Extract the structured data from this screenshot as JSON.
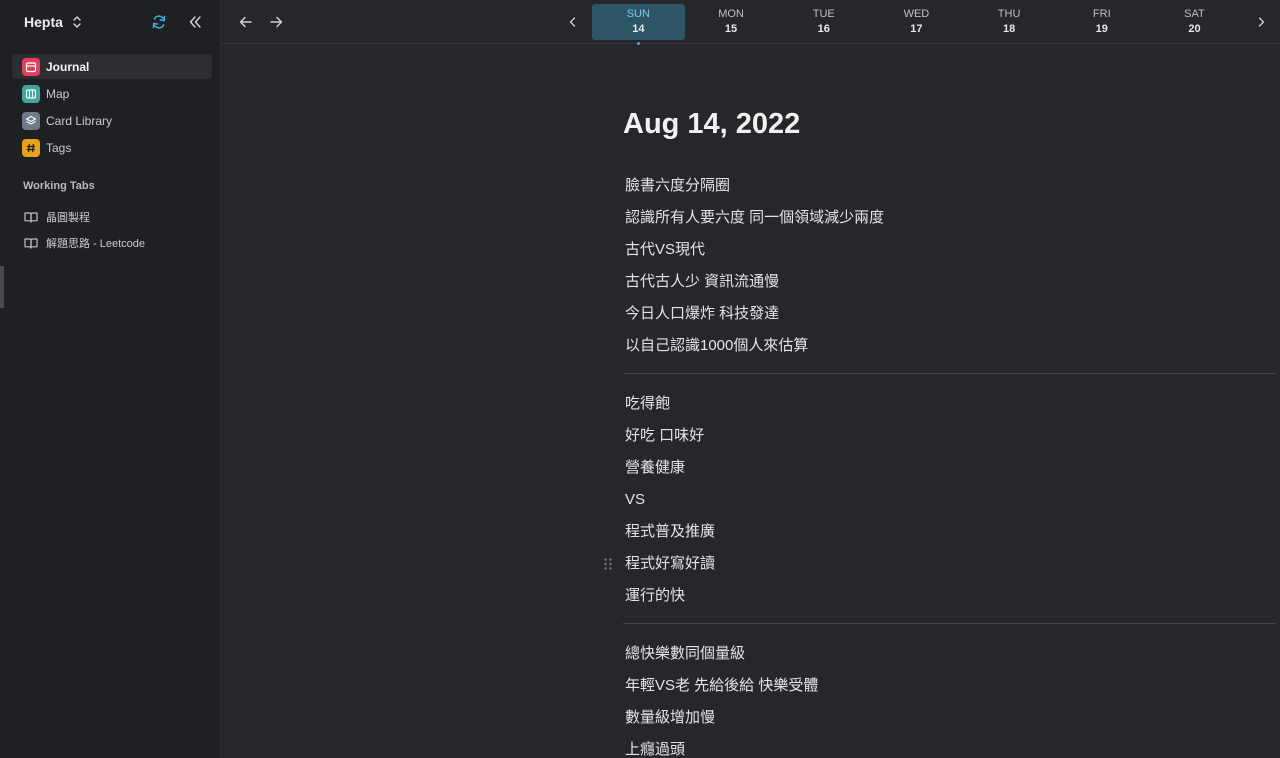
{
  "sidebar": {
    "workspace": "Hepta",
    "nav": [
      {
        "label": "Journal",
        "icon": "calendar-icon",
        "color": "#e0405e"
      },
      {
        "label": "Map",
        "icon": "map-icon",
        "color": "#3fa7a0"
      },
      {
        "label": "Card Library",
        "icon": "layers-icon",
        "color": "#6e7b8a"
      },
      {
        "label": "Tags",
        "icon": "hash-icon",
        "color": "#e9a11b"
      }
    ],
    "working_tabs_title": "Working Tabs",
    "tabs": [
      {
        "label": "晶圓製程",
        "icon": "book-icon"
      },
      {
        "label": "解題思路 - Leetcode",
        "icon": "book-icon"
      }
    ]
  },
  "calendar": {
    "days": [
      {
        "dow": "SUN",
        "num": "14",
        "selected": true
      },
      {
        "dow": "MON",
        "num": "15"
      },
      {
        "dow": "TUE",
        "num": "16"
      },
      {
        "dow": "WED",
        "num": "17"
      },
      {
        "dow": "THU",
        "num": "18"
      },
      {
        "dow": "FRI",
        "num": "19"
      },
      {
        "dow": "SAT",
        "num": "20"
      }
    ]
  },
  "journal": {
    "title": "Aug 14, 2022",
    "blocks": [
      [
        "臉書六度分隔圈",
        "認識所有人要六度  同一個領域減少兩度",
        "古代VS現代",
        "古代古人少 資訊流通慢",
        "今日人口爆炸 科技發達",
        "以自己認識1000個人來估算"
      ],
      [
        "吃得飽",
        "好吃 口味好",
        "營養健康",
        "VS",
        "程式普及推廣",
        "程式好寫好讀",
        "運行的快"
      ],
      [
        "總快樂數同個量級",
        "年輕VS老 先給後給 快樂受體",
        "數量級增加慢",
        "上癮過頭"
      ]
    ]
  },
  "colors": {
    "accent": "#4fa9d6",
    "selected_day_bg": "#2e5566",
    "sync_icon": "#3ea8e0"
  }
}
